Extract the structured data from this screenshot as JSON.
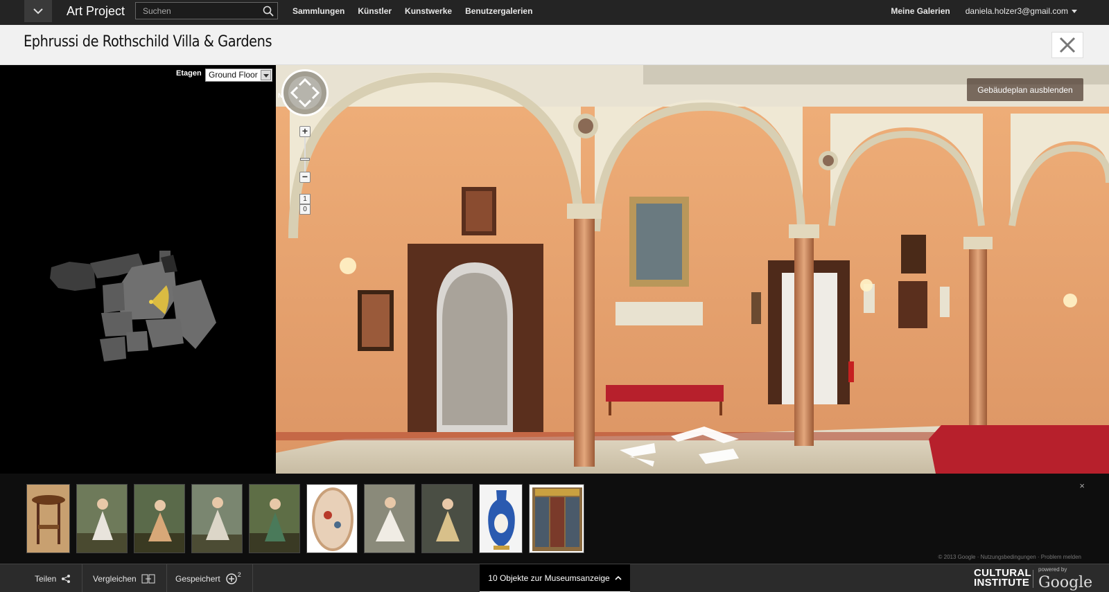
{
  "topbar": {
    "brand": "Art Project",
    "search_placeholder": "Suchen",
    "nav": [
      "Sammlungen",
      "Künstler",
      "Kunstwerke",
      "Benutzergalerien"
    ],
    "my_galleries": "Meine Galerien",
    "user_email": "daniela.holzer3@gmail.com"
  },
  "titlebar": {
    "title": "Ephrussi de Rothschild Villa & Gardens"
  },
  "floor": {
    "label": "Etagen",
    "selected": "Ground Floor"
  },
  "viewer": {
    "hide_plan_label": "Gebäudeplan ausblenden",
    "level_labels": [
      "1",
      "0"
    ],
    "zoom_in": "+",
    "zoom_out": "−",
    "compass": "N"
  },
  "strip": {
    "close": "×",
    "copyright": "© 2013 Google · Nutzungsbedingungen · Problem melden"
  },
  "bottombar": {
    "share_label": "Teilen",
    "compare_label": "Vergleichen",
    "saved_label": "Gespeichert",
    "saved_count": "2",
    "objects_label": "10 Objekte zur Museumsanzeige",
    "ci_line1": "CULTURAL",
    "ci_line2": "INSTITUTE",
    "powered_by": "powered by",
    "google": "Google"
  },
  "colors": {
    "wall": "#e7a46e",
    "floor": "#d9d2c3",
    "column": "#c98a61",
    "bench": "#b7202c",
    "frame": "#5a2f1d"
  }
}
